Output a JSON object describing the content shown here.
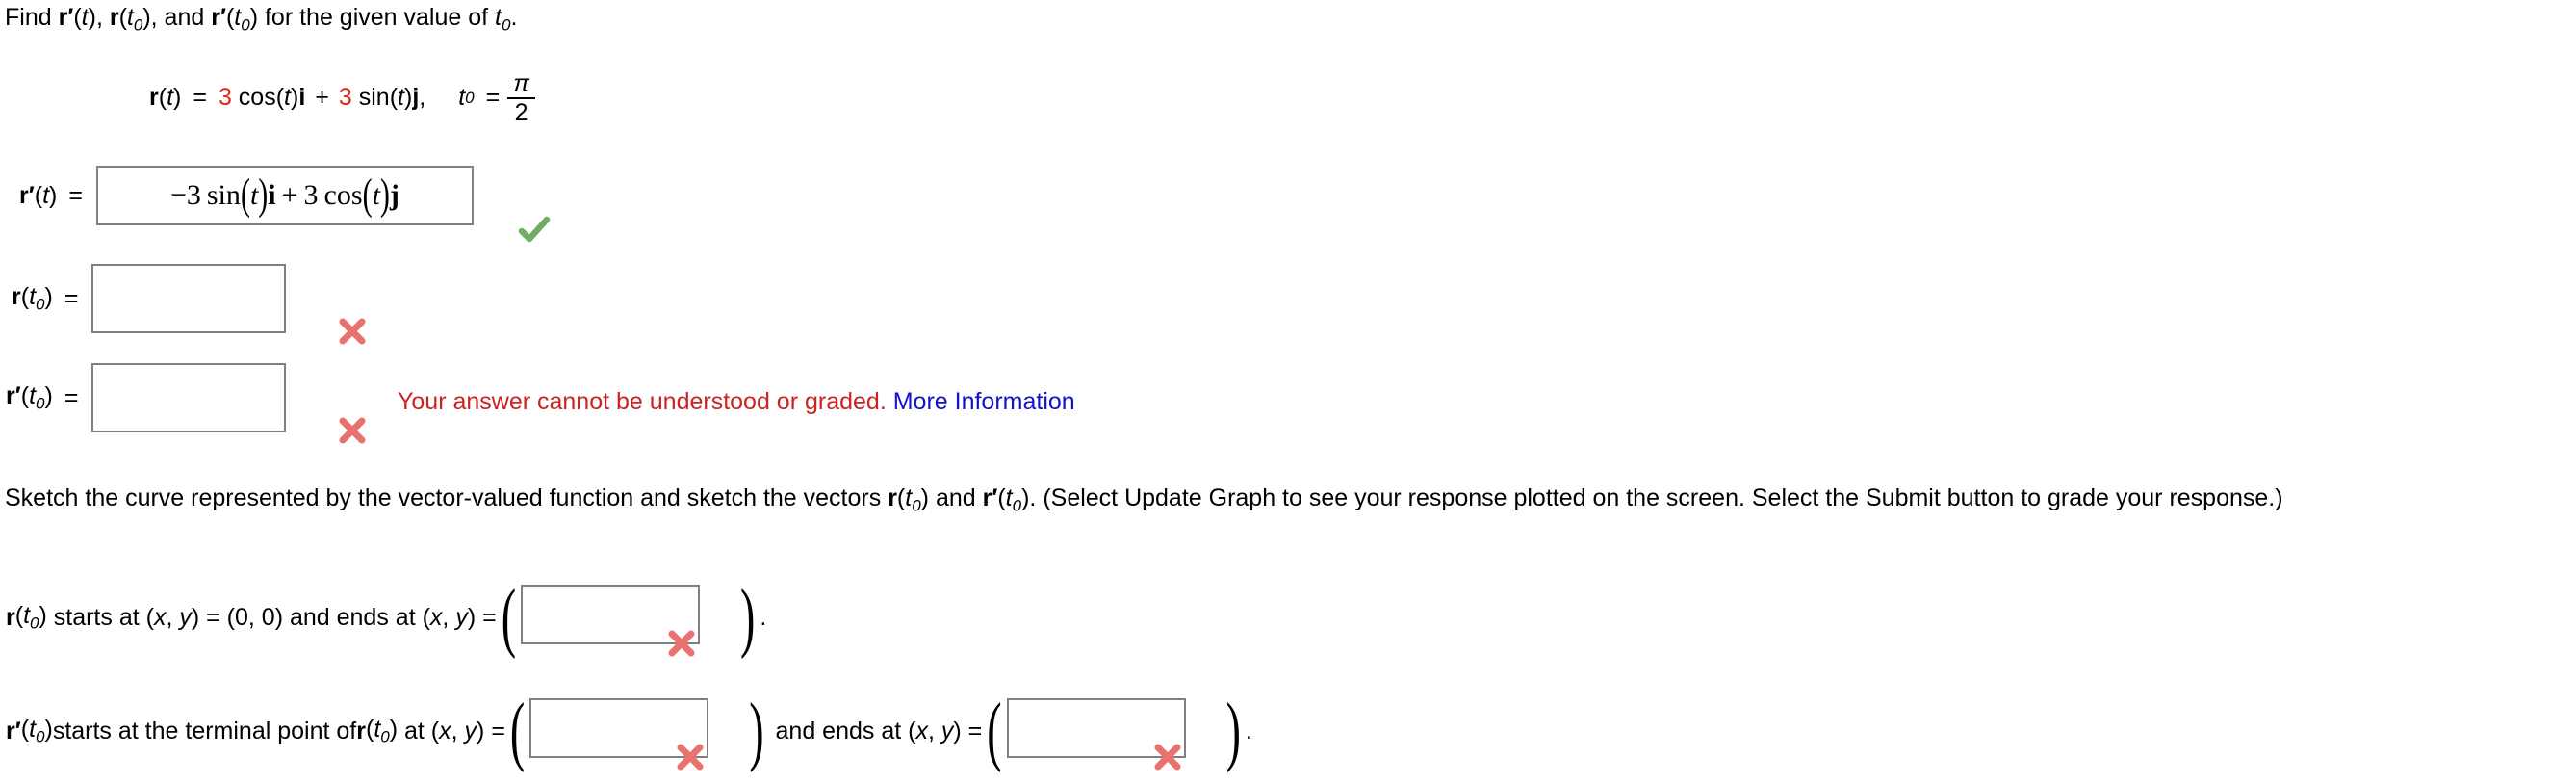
{
  "prompt": {
    "lead": "Find ",
    "item1_fn": "r",
    "item1_prime": "′",
    "item1_arg": "(t)",
    "comma1": ", ",
    "item2_fn": "r",
    "item2_arg_open": "(t",
    "item2_sub": "0",
    "item2_arg_close": ")",
    "comma2": ", and ",
    "item3_fn": "r",
    "item3_prime": "′",
    "item3_arg_open": "(t",
    "item3_sub": "0",
    "item3_arg_close": ")",
    "tail": " for the given value of ",
    "tail_var": "t",
    "tail_sub": "0",
    "tail_period": "."
  },
  "given": {
    "fn_name": "r",
    "fn_arg": "(t)",
    "equals": "=",
    "coef_i": "3",
    "term_i": " cos(",
    "term_i_var": "t",
    "term_i_close": ")",
    "unit_i": "i",
    "plus": "+",
    "coef_j": "3",
    "term_j": " sin(",
    "term_j_var": "t",
    "term_j_close": ")",
    "unit_j": "j",
    "comma": ",",
    "t0_var": "t",
    "t0_sub": "0",
    "t0_equals": "=",
    "t0_numerator": "π",
    "t0_denominator": "2",
    "coef_color": "#e8241c"
  },
  "answers": [
    {
      "label_fn": "r",
      "label_prime": "′",
      "label_arg": "(t)",
      "label_sub": "",
      "equals": "=",
      "value": "−3 sin(t)i + 3 cos(t)j",
      "value_parts": {
        "minus": "−3 sin",
        "open": "(",
        "var1": "t",
        "close": ")",
        "unit1": "i",
        "plus": "+ 3 cos",
        "open2": "(",
        "var2": "t",
        "close2": ")",
        "unit2": "j"
      },
      "status": "correct",
      "status_icon": "check-icon"
    },
    {
      "label_fn": "r",
      "label_prime": "",
      "label_arg": "(t",
      "label_sub": "0",
      "label_close": ")",
      "equals": "=",
      "value": "",
      "status": "incorrect",
      "status_icon": "cross-icon"
    },
    {
      "label_fn": "r",
      "label_prime": "′",
      "label_arg": "(t",
      "label_sub": "0",
      "label_close": ")",
      "equals": "=",
      "value": "",
      "status": "incorrect",
      "status_icon": "cross-icon"
    }
  ],
  "feedback": {
    "message": "Your answer cannot be understood or graded.",
    "link_label": "More Information",
    "message_color": "#cc2222",
    "link_color": "#1111cc"
  },
  "paragraph": {
    "part1": "Sketch the curve represented by the vector-valued function and sketch the vectors ",
    "vec1_fn": "r",
    "vec1_open": "(t",
    "vec1_sub": "0",
    "vec1_close": ")",
    "part2": " and ",
    "vec2_fn": "r",
    "vec2_prime": "′",
    "vec2_open": "(t",
    "vec2_sub": "0",
    "vec2_close": ")",
    "part3": ". (Select Update Graph to see your response plotted on the screen. Select the Submit button to grade your response.)"
  },
  "statement1": {
    "fn": "r",
    "open": "(t",
    "sub": "0",
    "close": ")",
    "text1": " starts at (",
    "x1": "x",
    "comma1": ", ",
    "y1": "y",
    "text2": ") = (0, 0) and ends at (",
    "x2": "x",
    "comma2": ", ",
    "y2": "y",
    "text3": ") = ",
    "paren_open": "(",
    "paren_close": ")",
    "period": ".",
    "box_value": "",
    "status_icon": "cross-icon"
  },
  "statement2": {
    "fn": "r",
    "prime": "′",
    "open": "(t",
    "sub": "0",
    "close": ")",
    "text1": " starts at the terminal point of ",
    "fn2": "r",
    "open2": "(t",
    "sub2": "0",
    "close2": ")",
    "text2": " at (",
    "x1": "x",
    "comma1": ", ",
    "y1": "y",
    "text3": ") = ",
    "paren_open": "(",
    "paren_close": ")",
    "mid_text": " and ends at (",
    "x2": "x",
    "comma2": ", ",
    "y2": "y",
    "text4": ") = ",
    "paren_open2": "(",
    "paren_close2": ")",
    "period": ".",
    "box1_value": "",
    "box2_value": "",
    "status_icon1": "cross-icon",
    "status_icon2": "cross-icon"
  },
  "colors": {
    "check_green": "#6fae63",
    "cross_red": "#e8736e",
    "box_border": "#808080"
  }
}
